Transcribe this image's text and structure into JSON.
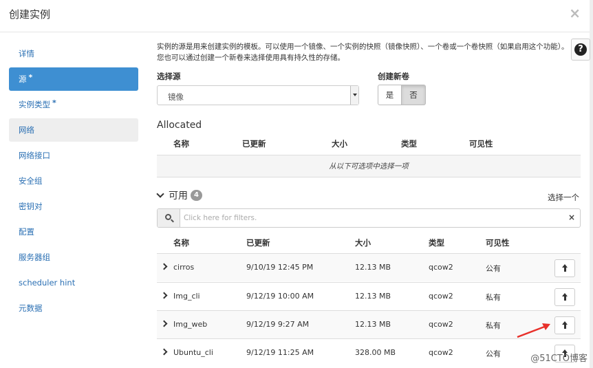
{
  "modal": {
    "title": "创建实例",
    "close": "×"
  },
  "sidebar": {
    "items": [
      {
        "label": "详情",
        "required": ""
      },
      {
        "label": "源",
        "required": "*"
      },
      {
        "label": "实例类型",
        "required": "*"
      },
      {
        "label": "网络",
        "required": ""
      },
      {
        "label": "网络接口",
        "required": ""
      },
      {
        "label": "安全组",
        "required": ""
      },
      {
        "label": "密钥对",
        "required": ""
      },
      {
        "label": "配置",
        "required": ""
      },
      {
        "label": "服务器组",
        "required": ""
      },
      {
        "label": "scheduler hint",
        "required": ""
      },
      {
        "label": "元数据",
        "required": ""
      }
    ]
  },
  "help": {
    "label": "?"
  },
  "description": "实例的源是用来创建实例的模板。可以使用一个镜像、一个实例的快照（镜像快照）、一个卷或一个卷快照（如果启用这个功能）。您也可以通过创建一个新卷来选择使用具有持久性的存储。",
  "source": {
    "label": "选择源",
    "value": "镜像"
  },
  "new_volume": {
    "label": "创建新卷",
    "yes": "是",
    "no": "否"
  },
  "allocated": {
    "title": "Allocated",
    "headers": [
      "名称",
      "已更新",
      "大小",
      "类型",
      "可见性"
    ],
    "empty_text": "从以下可选项中选择一项"
  },
  "available": {
    "title": "可用",
    "count": "4",
    "select_hint": "选择一个",
    "filter_placeholder": "Click here for filters.",
    "clear": "×",
    "headers": [
      "名称",
      "已更新",
      "大小",
      "类型",
      "可见性"
    ],
    "rows": [
      {
        "name": "cirros",
        "updated": "9/10/19 12:45 PM",
        "size": "12.13 MB",
        "type": "qcow2",
        "visibility": "公有"
      },
      {
        "name": "Img_cli",
        "updated": "9/12/19 10:00 AM",
        "size": "12.13 MB",
        "type": "qcow2",
        "visibility": "私有"
      },
      {
        "name": "Img_web",
        "updated": "9/12/19 9:27 AM",
        "size": "12.13 MB",
        "type": "qcow2",
        "visibility": "私有"
      },
      {
        "name": "Ubuntu_cli",
        "updated": "9/12/19 11:25 AM",
        "size": "328.00 MB",
        "type": "qcow2",
        "visibility": "公有"
      }
    ]
  },
  "watermark": "@51CTO博客",
  "colors": {
    "accent": "#3e8fd2",
    "link": "#2a6fb3",
    "arrow": "#e8302a"
  }
}
